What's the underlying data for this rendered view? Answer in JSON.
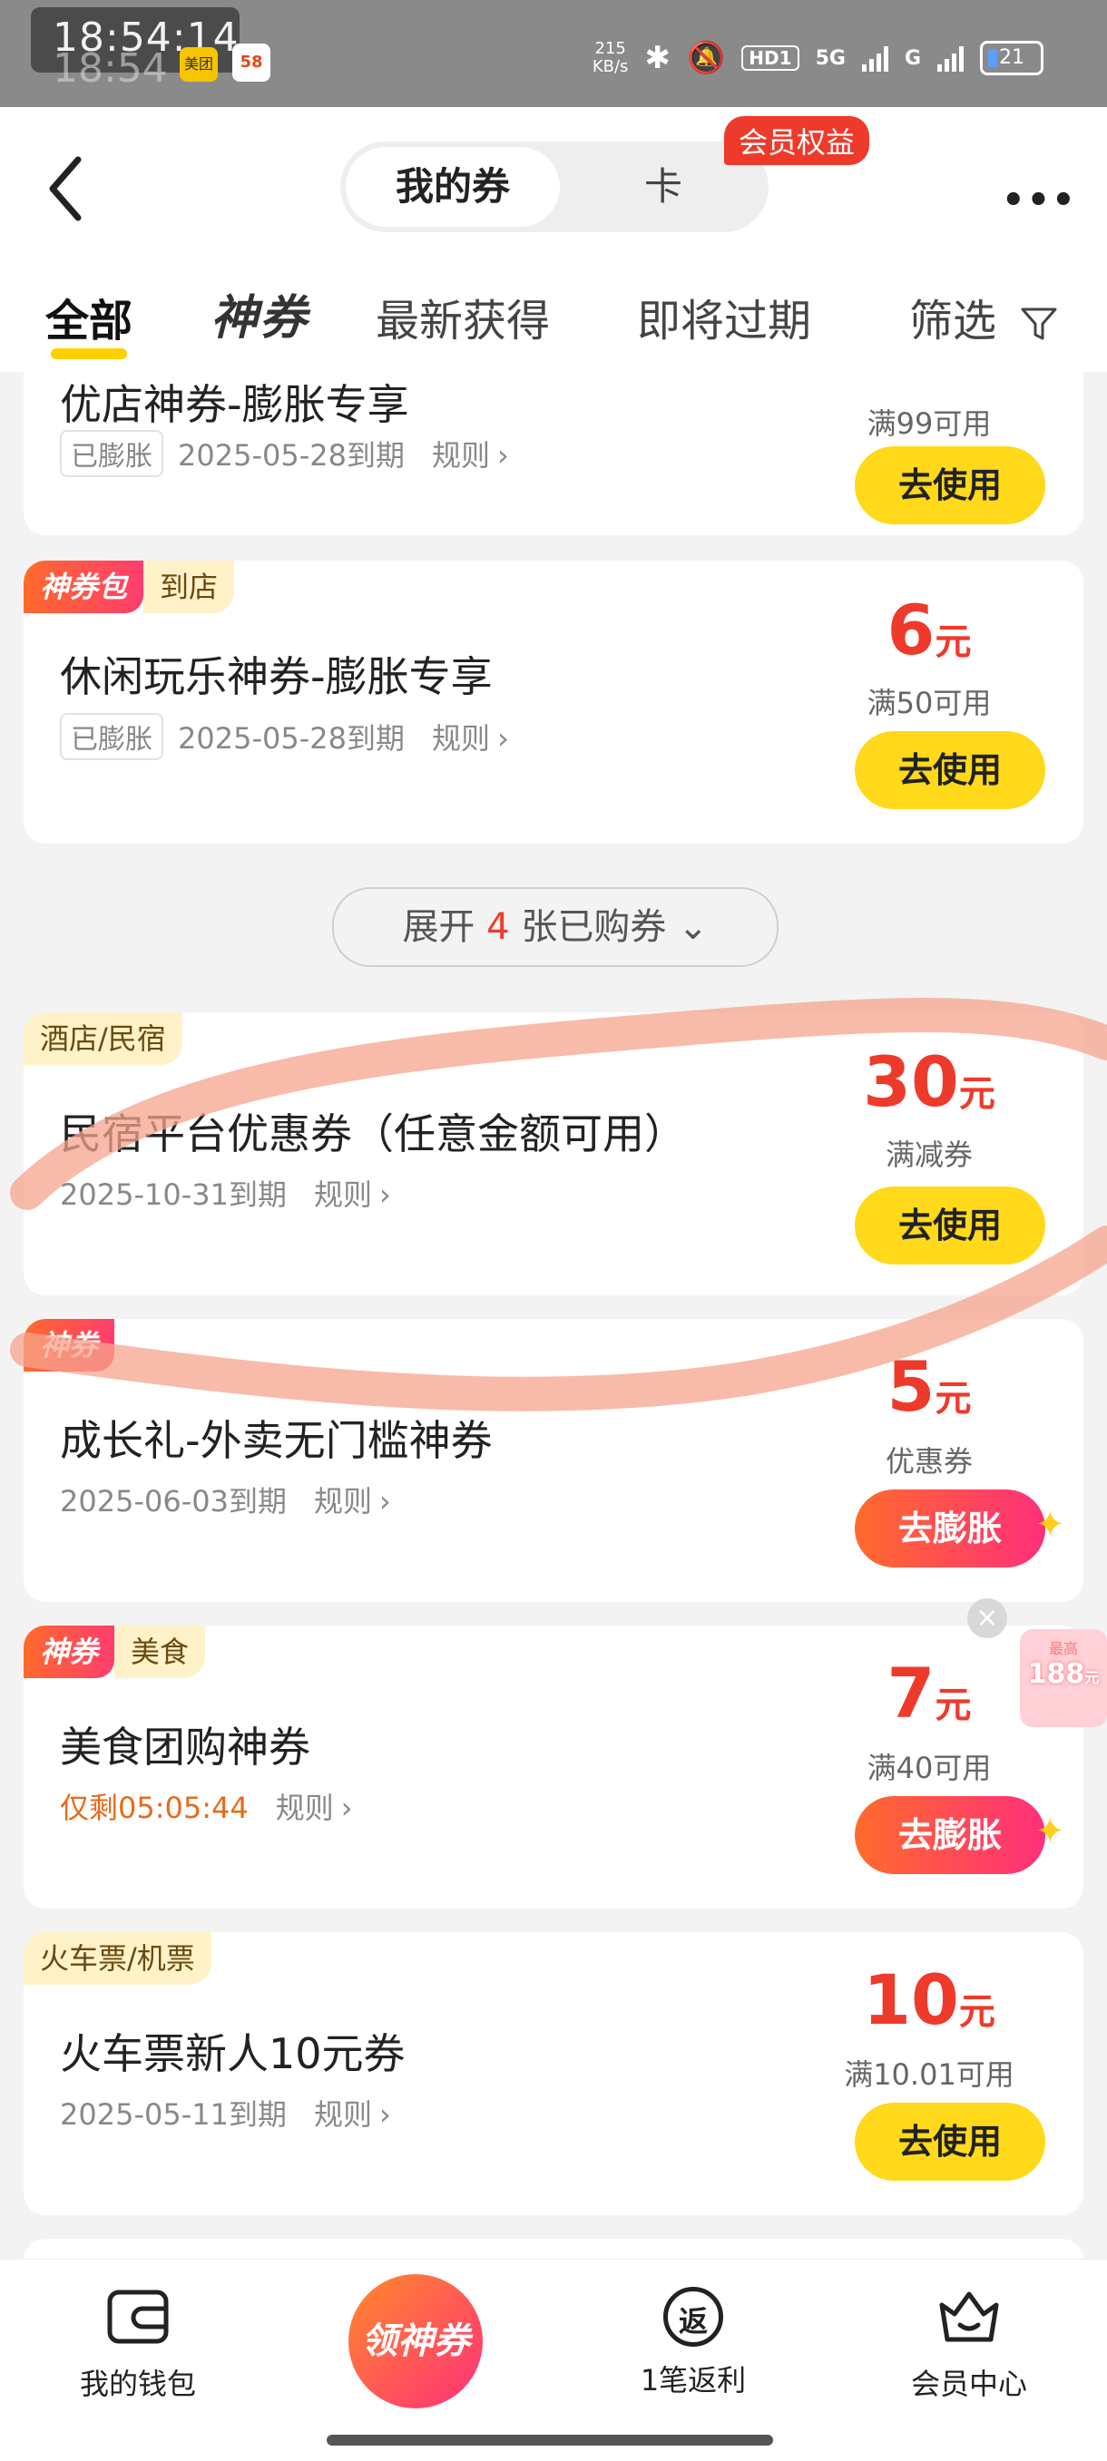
{
  "status_bar": {
    "time": "18:54:14",
    "time_ghost": "18:54",
    "app_icon_1": "美团",
    "app_icon_2": "58",
    "net_speed_value": "215",
    "net_speed_unit": "KB/s",
    "hd_label": "HD1",
    "network_1": "5G",
    "network_2": "G",
    "battery": "21"
  },
  "header": {
    "segment_active": "我的券",
    "segment_inactive": "卡",
    "vip_badge": "会员权益",
    "more": "•••"
  },
  "tabs": [
    {
      "label": "全部"
    },
    {
      "label": "神券"
    },
    {
      "label": "最新获得"
    },
    {
      "label": "即将过期"
    },
    {
      "label": "筛选"
    }
  ],
  "cards": [
    {
      "title": "优店神券-膨胀专享",
      "chip": "已膨胀",
      "expiry": "2025-05-28到期",
      "rule": "规则",
      "condition": "满99可用",
      "button": "去使用"
    },
    {
      "tag_primary": "神券包",
      "tag_secondary": "到店",
      "title": "休闲玩乐神券-膨胀专享",
      "chip": "已膨胀",
      "expiry": "2025-05-28到期",
      "rule": "规则",
      "amount": "6",
      "unit": "元",
      "condition": "满50可用",
      "button": "去使用"
    },
    {
      "tag_secondary": "酒店/民宿",
      "title": "民宿平台优惠券（任意金额可用）",
      "expiry": "2025-10-31到期",
      "rule": "规则",
      "amount": "30",
      "unit": "元",
      "condition": "满减券",
      "button": "去使用"
    },
    {
      "tag_primary": "神券",
      "title": "成长礼-外卖无门槛神券",
      "expiry": "2025-06-03到期",
      "rule": "规则",
      "amount": "5",
      "unit": "元",
      "condition": "优惠券",
      "button": "去膨胀"
    },
    {
      "tag_primary": "神券",
      "tag_secondary": "美食",
      "title": "美食团购神券",
      "countdown": "仅剩05:05:44",
      "rule": "规则",
      "amount": "7",
      "unit": "元",
      "condition": "满40可用",
      "button": "去膨胀"
    },
    {
      "tag_secondary": "火车票/机票",
      "title": "火车票新人10元券",
      "expiry": "2025-05-11到期",
      "rule": "规则",
      "amount": "10",
      "unit": "元",
      "condition": "满10.01可用",
      "button": "去使用"
    }
  ],
  "expand": {
    "prefix": "展开",
    "count": "4",
    "suffix": "张已购券"
  },
  "float_widget": {
    "top": "最高",
    "amount": "188",
    "unit": "元"
  },
  "bottom_nav": {
    "wallet": "我的钱包",
    "center": "领神券",
    "rebate_icon": "返",
    "rebate": "1笔返利",
    "member": "会员中心"
  },
  "colors": {
    "accent_red": "#ee3a2b",
    "use_button": "#ffd91a",
    "tab_underline": "#ffd000",
    "status_bar": "#8a8a8a"
  }
}
